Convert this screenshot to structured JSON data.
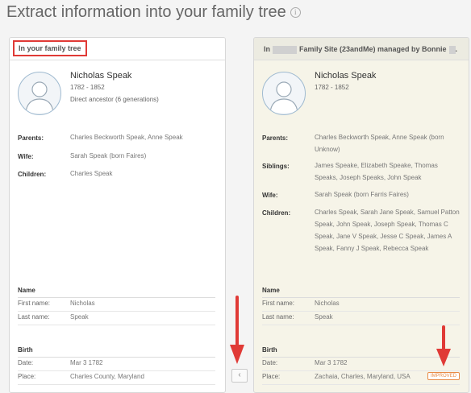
{
  "page": {
    "title": "Extract information into your family tree"
  },
  "left": {
    "header": "In your family tree",
    "name": "Nicholas Speak",
    "dates": "1782 - 1852",
    "relation": "Direct ancestor (6 generations)",
    "labels": {
      "parents": "Parents:",
      "wife": "Wife:",
      "children": "Children:"
    },
    "parents": "Charles Beckworth Speak, Anne Speak",
    "wife": "Sarah Speak (born Faires)",
    "children": "Charles Speak",
    "name_section": {
      "title": "Name",
      "first_label": "First name:",
      "first": "Nicholas",
      "last_label": "Last name:",
      "last": "Speak"
    },
    "birth_section": {
      "title": "Birth",
      "date_label": "Date:",
      "date": "Mar 3 1782",
      "place_label": "Place:",
      "place": "Charles County, Maryland"
    }
  },
  "right": {
    "header_in": "In",
    "header_site": "Family Site (23andMe) managed by Bonnie",
    "header_end": ".",
    "name": "Nicholas Speak",
    "dates": "1782 - 1852",
    "labels": {
      "parents": "Parents:",
      "siblings": "Siblings:",
      "wife": "Wife:",
      "children": "Children:"
    },
    "parents": "Charles Beckworth Speak, Anne Speak (born Unknow)",
    "siblings": "James Speake, Elizabeth Speake, Thomas Speaks, Joseph Speaks, John Speak",
    "wife": "Sarah Speak (born Farris Faires)",
    "children": "Charles Speak, Sarah Jane Speak, Samuel Patton Speak, John Speak, Joseph Speak, Thomas C Speak, Jane V Speak, Jesse C Speak, James A Speak, Fanny J Speak, Rebecca Speak",
    "name_section": {
      "title": "Name",
      "first_label": "First name:",
      "first": "Nicholas",
      "last_label": "Last name:",
      "last": "Speak"
    },
    "birth_section": {
      "title": "Birth",
      "date_label": "Date:",
      "date": "Mar 3 1782",
      "place_label": "Place:",
      "place": "Zachaia, Charles, Maryland, USA",
      "badge": "IMPROVED"
    }
  },
  "nav": {
    "prev_glyph": "‹"
  },
  "icons": {
    "info": "info-icon",
    "avatar": "person-silhouette-icon",
    "arrow": "red-arrow-down-icon"
  },
  "colors": {
    "highlight": "#e03a36",
    "improved_badge": "#e98b46",
    "right_panel_bg": "#f6f4e8"
  }
}
